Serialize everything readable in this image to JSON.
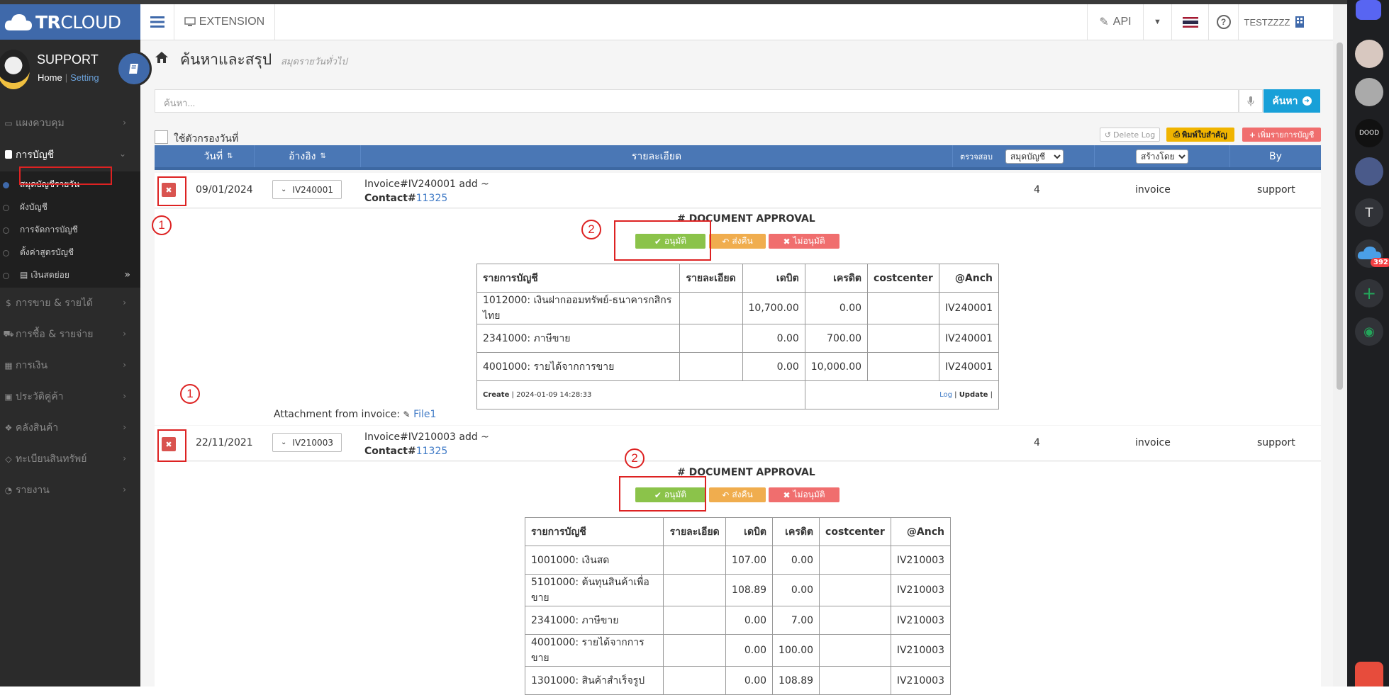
{
  "app": {
    "logo_bold": "TR",
    "logo_light": "CLOUD",
    "ext_label": "EXTENSION",
    "api_label": "API",
    "user_label": "TESTZZZZ"
  },
  "profile": {
    "name": "SUPPORT",
    "home": "Home",
    "sep": "|",
    "setting": "Setting"
  },
  "sidebar": {
    "items": [
      {
        "icon": "monitor-icon",
        "label": "แผงควบคุม"
      },
      {
        "icon": "book-icon",
        "label": "การบัญชี"
      },
      {
        "icon": "dollar-icon",
        "label": "การขาย & รายได้"
      },
      {
        "icon": "cart-icon",
        "label": "การซื้อ & รายจ่าย"
      },
      {
        "icon": "calendar-icon",
        "label": "การเงิน"
      },
      {
        "icon": "id-icon",
        "label": "ประวัติคู่ค้า"
      },
      {
        "icon": "boxes-icon",
        "label": "คลังสินค้า"
      },
      {
        "icon": "diamond-icon",
        "label": "ทะเบียนสินทรัพย์"
      },
      {
        "icon": "chart-icon",
        "label": "รายงาน"
      }
    ],
    "subitems": [
      "สมุดบัญชีรายวัน",
      "ผังบัญชี",
      "การจัดการบัญชี",
      "ตั้งค่าสูตรบัญชี",
      "เงินสดย่อย"
    ]
  },
  "page": {
    "title": "ค้นหาและสรุป",
    "subtitle": "สมุดรายวันทั่วไป"
  },
  "search": {
    "placeholder": "ค้นหา...",
    "button": "ค้นหา"
  },
  "filter": {
    "label": "ใช้ตัวกรองวันที่"
  },
  "toolbar": {
    "delete_log": "Delete Log",
    "print": "พิมพ์ใบสำคัญ",
    "add": "เพิ่มรายการบัญชี"
  },
  "table_head": {
    "date": "วันที่",
    "ref": "อ้างอิง",
    "detail": "รายละเอียด",
    "check": "ตรวจสอบ",
    "book_select": "สมุดบัญชี",
    "created_by_select": "สร้างโดย",
    "by": "By"
  },
  "entries": [
    {
      "date": "09/01/2024",
      "ref": "IV240001",
      "detail_line1": "Invoice#IV240001 add ~",
      "contact_label": "Contact#",
      "contact_id": "11325",
      "count": "4",
      "book": "invoice",
      "by": "support",
      "rows": [
        {
          "account": "1012000: เงินฝากออมทรัพย์-ธนาคารกสิกรไทย",
          "detail": "",
          "debit": "10,700.00",
          "credit": "0.00",
          "cc": "",
          "anch": "IV240001"
        },
        {
          "account": "2341000: ภาษีขาย",
          "detail": "",
          "debit": "0.00",
          "credit": "700.00",
          "cc": "",
          "anch": "IV240001"
        },
        {
          "account": "4001000: รายได้จากการขาย",
          "detail": "",
          "debit": "0.00",
          "credit": "10,000.00",
          "cc": "",
          "anch": "IV240001"
        }
      ],
      "footer_create": "Create",
      "footer_time": "2024-01-09 14:28:33",
      "footer_log": "Log",
      "footer_update": "Update",
      "attachment_label": "Attachment from invoice:",
      "attachment_file": "File1"
    },
    {
      "date": "22/11/2021",
      "ref": "IV210003",
      "detail_line1": "Invoice#IV210003 add ~",
      "contact_label": "Contact#",
      "contact_id": "11325",
      "count": "4",
      "book": "invoice",
      "by": "support",
      "rows": [
        {
          "account": "1001000: เงินสด",
          "detail": "",
          "debit": "107.00",
          "credit": "0.00",
          "cc": "",
          "anch": "IV210003"
        },
        {
          "account": "5101000: ต้นทุนสินค้าเพื่อขาย",
          "detail": "",
          "debit": "108.89",
          "credit": "0.00",
          "cc": "",
          "anch": "IV210003"
        },
        {
          "account": "2341000: ภาษีขาย",
          "detail": "",
          "debit": "0.00",
          "credit": "7.00",
          "cc": "",
          "anch": "IV210003"
        },
        {
          "account": "4001000: รายได้จากการขาย",
          "detail": "",
          "debit": "0.00",
          "credit": "100.00",
          "cc": "",
          "anch": "IV210003"
        },
        {
          "account": "1301000: สินค้าสำเร็จรูป",
          "detail": "",
          "debit": "0.00",
          "credit": "108.89",
          "cc": "",
          "anch": "IV210003"
        }
      ]
    }
  ],
  "acc_head": {
    "account": "รายการบัญชี",
    "detail": "รายละเอียด",
    "debit": "เดบิต",
    "credit": "เครดิต",
    "cc": "costcenter",
    "anch": "@Anch"
  },
  "approval": {
    "title": "# DOCUMENT APPROVAL",
    "approve": "อนุมัติ",
    "return": "ส่งคืน",
    "reject": "ไม่อนุมัติ"
  },
  "annotations": {
    "one": "1",
    "two": "2"
  },
  "rightbar": {
    "t_letter": "T",
    "badge": "392",
    "wide_label": "DOOD"
  },
  "colors": {
    "brand": "#3f69aa",
    "header_blue": "#4a77b5",
    "approve": "#8bc34a",
    "return": "#f0ad4e",
    "reject": "#f06e6e",
    "danger": "#d9534f"
  }
}
